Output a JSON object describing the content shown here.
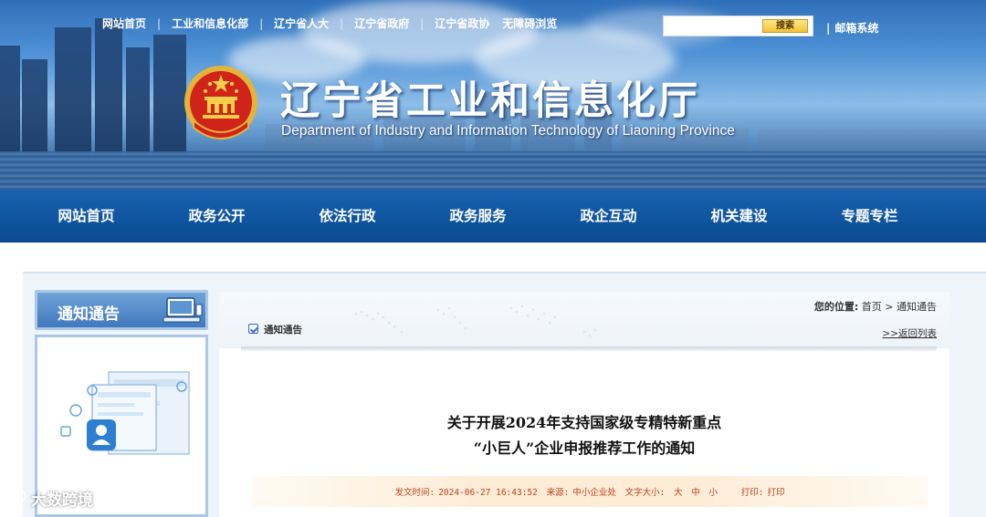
{
  "header": {
    "top_links": [
      "网站首页",
      "工业和信息化部",
      "辽宁省人大",
      "辽宁省政府",
      "辽宁省政协",
      "无障碍浏览"
    ],
    "search_placeholder": "",
    "search_button": "搜索",
    "mail_system": "邮箱系统",
    "site_title": "辽宁省工业和信息化厅",
    "site_subtitle": "Department of Industry and Information Technology of Liaoning Province"
  },
  "nav": {
    "items": [
      "网站首页",
      "政务公开",
      "依法行政",
      "政务服务",
      "政企互动",
      "机关建设",
      "专题专栏"
    ]
  },
  "sidebar": {
    "title": "通知通告"
  },
  "main": {
    "location_label": "您的位置:",
    "breadcrumb_home": "首页",
    "breadcrumb_sep": ">",
    "breadcrumb_current": "通知通告",
    "section_tag": "通知通告",
    "back_link": ">>返回列表",
    "article_title_line1": "关于开展2024年支持国家级专精特新重点",
    "article_title_line2": "“小巨人”企业申报推荐工作的通知",
    "meta": {
      "publish_label": "发文时间:",
      "publish_time": "2024-06-27 16:43:52",
      "source_label": "来源:",
      "source": "中小企业处",
      "font_size_label": "文字大小:",
      "font_large": "大",
      "font_medium": "中",
      "font_small": "小",
      "print_label": "打印:",
      "print": "打印"
    }
  },
  "watermark": {
    "text": "大数跨境"
  },
  "colors": {
    "nav_blue": "#0f55a0",
    "meta_red": "#c0421f"
  }
}
